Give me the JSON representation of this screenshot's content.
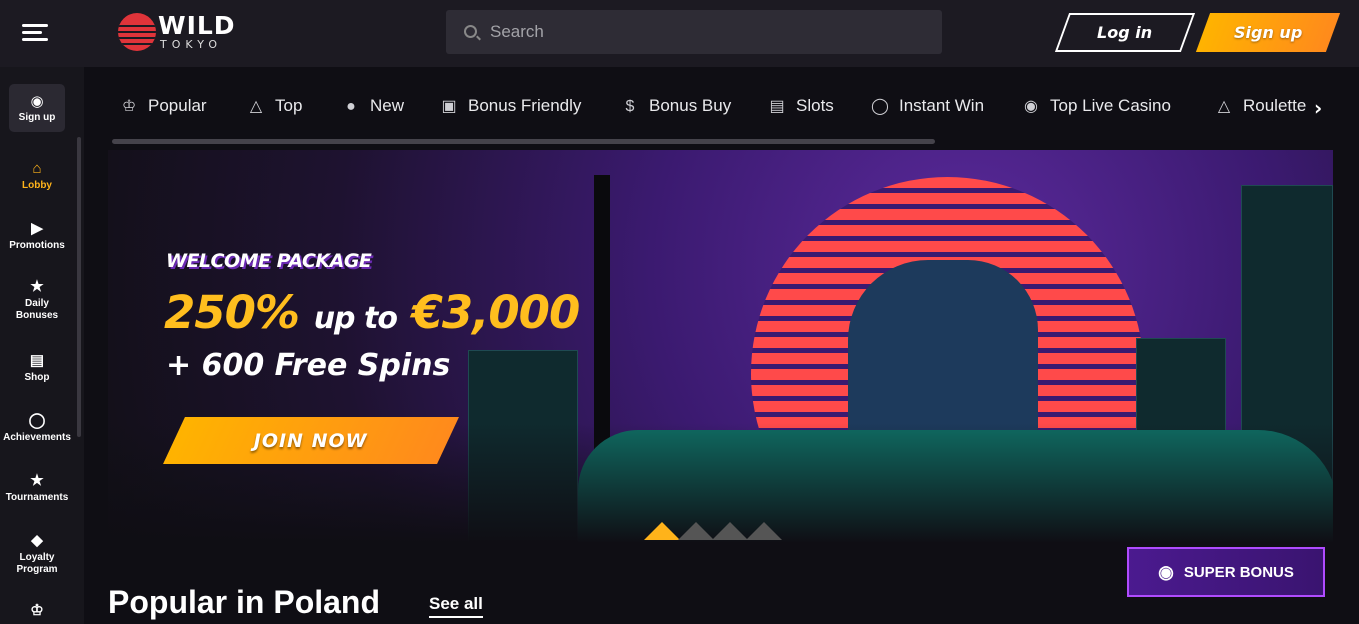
{
  "header": {
    "logo_word": "WILD",
    "logo_sub": "TOKYO",
    "search_placeholder": "Search",
    "login_label": "Log in",
    "signup_label": "Sign up"
  },
  "sidebar": {
    "signup_label": "Sign up",
    "items": [
      {
        "label": "Lobby",
        "icon": "home-icon",
        "active": true
      },
      {
        "label": "Promotions",
        "icon": "megaphone-icon"
      },
      {
        "label": "Daily Bonuses",
        "icon": "calendar-star-icon"
      },
      {
        "label": "Shop",
        "icon": "shop-icon"
      },
      {
        "label": "Achievements",
        "icon": "medal-icon"
      },
      {
        "label": "Tournaments",
        "icon": "trophy-icon"
      },
      {
        "label": "Loyalty Program",
        "icon": "diamond-icon"
      },
      {
        "label": "",
        "icon": "crown-icon"
      }
    ]
  },
  "categories": [
    {
      "label": "Popular",
      "icon": "crown-icon"
    },
    {
      "label": "Top",
      "icon": "flame-icon"
    },
    {
      "label": "New",
      "icon": "new-icon"
    },
    {
      "label": "Bonus Friendly",
      "icon": "gift-icon"
    },
    {
      "label": "Bonus Buy",
      "icon": "money-bag-icon"
    },
    {
      "label": "Slots",
      "icon": "slot-machine-icon"
    },
    {
      "label": "Instant Win",
      "icon": "stopwatch-icon"
    },
    {
      "label": "Top Live Casino",
      "icon": "chip-icon"
    },
    {
      "label": "Roulette",
      "icon": "roulette-icon"
    }
  ],
  "hero": {
    "package_label": "WELCOME PACKAGE",
    "percent": "250%",
    "up_to": "up to",
    "amount": "€3,000",
    "spins": "+ 600 Free Spins",
    "cta": "JOIN NOW",
    "slides_total": 4,
    "slide_active": 1
  },
  "super_bonus_label": "SUPER BONUS",
  "section": {
    "title": "Popular in Poland",
    "see_all": "See all"
  },
  "colors": {
    "accent": "#ffb31a",
    "background": "#0f0e14",
    "header": "#1c1a22",
    "purple": "#4b1a8f"
  }
}
